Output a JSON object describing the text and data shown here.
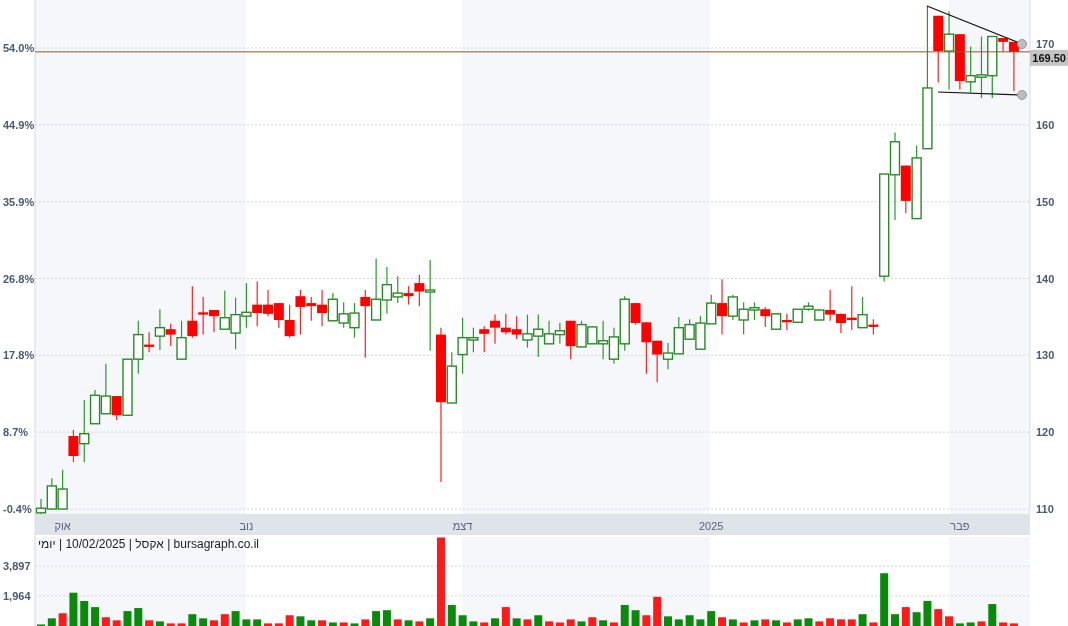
{
  "price_chart": {
    "percent_labels": [
      "54.0%",
      "44.9%",
      "35.9%",
      "26.8%",
      "17.8%",
      "8.7%",
      "-0.4%"
    ],
    "chart_data": {
      "type": "candlestick",
      "ohlc": [
        [
          109.5,
          111.3,
          109.3,
          110.1
        ],
        [
          110.0,
          114.0,
          109.9,
          113.0
        ],
        [
          110.0,
          115.1,
          110.0,
          112.6
        ],
        [
          119.5,
          120.3,
          116.1,
          116.9
        ],
        [
          118.5,
          124.2,
          116.1,
          119.8
        ],
        [
          121.1,
          125.5,
          121.1,
          124.8
        ],
        [
          122.4,
          128.9,
          122.4,
          124.7
        ],
        [
          124.7,
          124.7,
          121.6,
          122.2
        ],
        [
          122.2,
          129.5,
          122.2,
          129.5
        ],
        [
          129.5,
          134.5,
          127.6,
          132.7
        ],
        [
          131.4,
          133.0,
          130.4,
          131.1
        ],
        [
          132.5,
          136.0,
          130.7,
          133.6
        ],
        [
          133.4,
          134.1,
          131.2,
          132.7
        ],
        [
          129.5,
          134.5,
          129.5,
          132.3
        ],
        [
          134.5,
          139.0,
          132.3,
          132.5
        ],
        [
          135.6,
          137.6,
          132.7,
          135.3
        ],
        [
          135.9,
          135.9,
          133.0,
          135.1
        ],
        [
          133.4,
          138.4,
          133.4,
          134.9
        ],
        [
          132.9,
          137.5,
          130.8,
          135.3
        ],
        [
          135.1,
          139.4,
          133.6,
          135.6
        ],
        [
          136.6,
          139.6,
          133.8,
          135.5
        ],
        [
          136.6,
          138.5,
          135.1,
          135.4
        ],
        [
          136.8,
          136.8,
          133.6,
          134.6
        ],
        [
          134.6,
          136.6,
          132.3,
          132.5
        ],
        [
          137.7,
          138.5,
          132.7,
          136.3
        ],
        [
          136.8,
          137.6,
          134.5,
          136.4
        ],
        [
          136.6,
          138.5,
          133.8,
          135.5
        ],
        [
          134.5,
          138.1,
          134.5,
          137.3
        ],
        [
          134.2,
          136.9,
          133.6,
          135.4
        ],
        [
          133.6,
          136.8,
          132.3,
          135.5
        ],
        [
          137.6,
          138.5,
          129.7,
          136.4
        ],
        [
          134.6,
          142.6,
          134.6,
          137.3
        ],
        [
          137.2,
          141.5,
          135.4,
          139.2
        ],
        [
          137.6,
          140.3,
          136.8,
          138.1
        ],
        [
          138.1,
          139.0,
          136.6,
          137.7
        ],
        [
          139.4,
          140.5,
          136.4,
          138.3
        ],
        [
          138.3,
          142.4,
          130.6,
          138.5
        ],
        [
          132.7,
          133.6,
          113.5,
          123.9
        ],
        [
          123.8,
          130.4,
          123.8,
          128.6
        ],
        [
          130.1,
          134.9,
          127.6,
          132.3
        ],
        [
          132.0,
          133.6,
          130.4,
          132.3
        ],
        [
          133.4,
          133.8,
          130.4,
          132.8
        ],
        [
          134.5,
          135.3,
          131.5,
          133.6
        ],
        [
          133.6,
          135.4,
          132.7,
          133.0
        ],
        [
          133.4,
          135.1,
          132.1,
          132.7
        ],
        [
          132.0,
          135.3,
          131.0,
          132.8
        ],
        [
          132.5,
          135.3,
          129.8,
          133.4
        ],
        [
          131.5,
          134.5,
          131.5,
          132.8
        ],
        [
          132.7,
          134.2,
          131.5,
          133.2
        ],
        [
          134.5,
          134.5,
          129.5,
          131.2
        ],
        [
          131.1,
          134.5,
          131.1,
          134.0
        ],
        [
          131.5,
          133.8,
          131.5,
          133.7
        ],
        [
          131.5,
          134.5,
          129.5,
          131.9
        ],
        [
          129.5,
          133.6,
          128.9,
          132.4
        ],
        [
          131.5,
          137.7,
          130.6,
          137.3
        ],
        [
          136.8,
          136.8,
          134.0,
          134.2
        ],
        [
          134.3,
          134.3,
          127.6,
          131.7
        ],
        [
          131.9,
          131.9,
          126.5,
          130.1
        ],
        [
          129.5,
          131.6,
          128.2,
          130.3
        ],
        [
          130.2,
          135.0,
          130.2,
          133.6
        ],
        [
          132.1,
          134.7,
          132.1,
          134.0
        ],
        [
          130.8,
          135.1,
          130.8,
          134.2
        ],
        [
          134.1,
          137.9,
          134.1,
          136.8
        ],
        [
          136.8,
          139.9,
          132.7,
          135.1
        ],
        [
          135.1,
          137.9,
          134.6,
          137.6
        ],
        [
          134.6,
          136.9,
          132.7,
          136.0
        ],
        [
          135.9,
          136.9,
          134.6,
          136.2
        ],
        [
          136.0,
          136.3,
          133.7,
          135.1
        ],
        [
          133.4,
          135.5,
          133.4,
          135.4
        ],
        [
          134.6,
          135.4,
          133.3,
          134.3
        ],
        [
          134.3,
          136.0,
          134.3,
          136.0
        ],
        [
          136.0,
          136.9,
          135.8,
          136.4
        ],
        [
          134.6,
          136.0,
          134.6,
          135.9
        ],
        [
          135.9,
          138.5,
          134.5,
          135.3
        ],
        [
          135.4,
          135.4,
          132.9,
          134.2
        ],
        [
          134.9,
          139.0,
          133.3,
          134.6
        ],
        [
          133.6,
          137.6,
          133.6,
          135.3
        ],
        [
          134.0,
          134.7,
          132.7,
          133.7
        ],
        [
          140.3,
          153.6,
          139.6,
          153.6
        ],
        [
          153.5,
          159.0,
          147.6,
          157.8
        ],
        [
          154.7,
          154.7,
          148.5,
          150.1
        ],
        [
          147.8,
          157.3,
          147.8,
          155.7
        ],
        [
          156.9,
          175.5,
          156.9,
          164.8
        ],
        [
          174.2,
          174.2,
          165.5,
          169.6
        ],
        [
          169.6,
          174.8,
          164.6,
          171.8
        ],
        [
          171.8,
          171.8,
          164.6,
          165.7
        ],
        [
          165.6,
          170.2,
          164.2,
          166.4
        ],
        [
          166.2,
          171.5,
          163.5,
          166.5
        ],
        [
          166.4,
          171.5,
          163.5,
          171.5
        ],
        [
          171.3,
          171.3,
          169.5,
          170.8
        ],
        [
          170.8,
          170.8,
          164.4,
          169.5
        ]
      ],
      "categories": [
        null,
        null,
        "אוק",
        null,
        null,
        null,
        null,
        null,
        null,
        null,
        null,
        null,
        null,
        null,
        null,
        null,
        null,
        null,
        null,
        "נוב",
        null,
        null,
        null,
        null,
        null,
        null,
        null,
        null,
        null,
        null,
        null,
        null,
        null,
        null,
        null,
        null,
        null,
        null,
        null,
        "דצמ",
        null,
        null,
        null,
        null,
        null,
        null,
        null,
        null,
        null,
        null,
        null,
        null,
        null,
        null,
        null,
        null,
        null,
        null,
        null,
        null,
        null,
        null,
        "2025",
        null,
        null,
        null,
        null,
        null,
        null,
        null,
        null,
        null,
        null,
        null,
        null,
        null,
        null,
        null,
        null,
        null,
        null,
        null,
        null,
        null,
        null,
        "פבר",
        null,
        null,
        null,
        null,
        null
      ],
      "ylim": [
        109.35,
        176.25
      ],
      "grid": true,
      "ref_lines": [
        {
          "axis": "y",
          "value": 169.5,
          "label": "169.50"
        }
      ],
      "yticks": [
        170,
        160,
        150,
        140,
        130,
        120,
        110
      ]
    }
  },
  "caption": "bursagraph.co.il | אקסל | 10/02/2025 | יומי",
  "volume_chart": {
    "chart_data": {
      "type": "bar",
      "ylim": [
        0,
        5800
      ],
      "grid": true,
      "yticks": [
        {
          "value": 3897,
          "label": "3,897"
        },
        {
          "value": 1964,
          "label": "1,964"
        }
      ],
      "series": [
        {
          "color": "#0a8a0a",
          "values": [
            100,
            500,
            null,
            2170,
            1630,
            1230,
            null,
            null,
            970,
            1170,
            null,
            300,
            null,
            null,
            770,
            500,
            null,
            null,
            970,
            430,
            430,
            null,
            null,
            null,
            630,
            370,
            null,
            230,
            null,
            170,
            null,
            970,
            1030,
            null,
            370,
            null,
            500,
            null,
            1370,
            700,
            300,
            null,
            500,
            null,
            500,
            null,
            700,
            null,
            null,
            null,
            300,
            null,
            370,
            null,
            1370,
            1030,
            null,
            null,
            630,
            430,
            700,
            430,
            970,
            null,
            430,
            null,
            370,
            null,
            370,
            null,
            430,
            500,
            null,
            null,
            null,
            null,
            770,
            null,
            3440,
            770,
            null,
            900,
            1630,
            null,
            null,
            170,
            230,
            null,
            1430,
            null,
            null
          ]
        },
        {
          "color": "#ff1a1a",
          "values": [
            null,
            null,
            830,
            null,
            null,
            null,
            570,
            370,
            null,
            null,
            370,
            null,
            170,
            170,
            null,
            null,
            370,
            770,
            null,
            null,
            null,
            170,
            170,
            700,
            null,
            null,
            370,
            null,
            230,
            null,
            430,
            null,
            null,
            430,
            null,
            300,
            null,
            5770,
            null,
            null,
            null,
            230,
            null,
            1230,
            null,
            430,
            null,
            300,
            230,
            430,
            null,
            570,
            null,
            230,
            null,
            null,
            700,
            1900,
            null,
            null,
            null,
            null,
            null,
            570,
            null,
            230,
            null,
            430,
            null,
            230,
            null,
            null,
            300,
            500,
            430,
            430,
            null,
            230,
            null,
            null,
            1230,
            null,
            null,
            1100,
            630,
            null,
            null,
            300,
            null,
            230,
            170
          ]
        }
      ]
    }
  }
}
